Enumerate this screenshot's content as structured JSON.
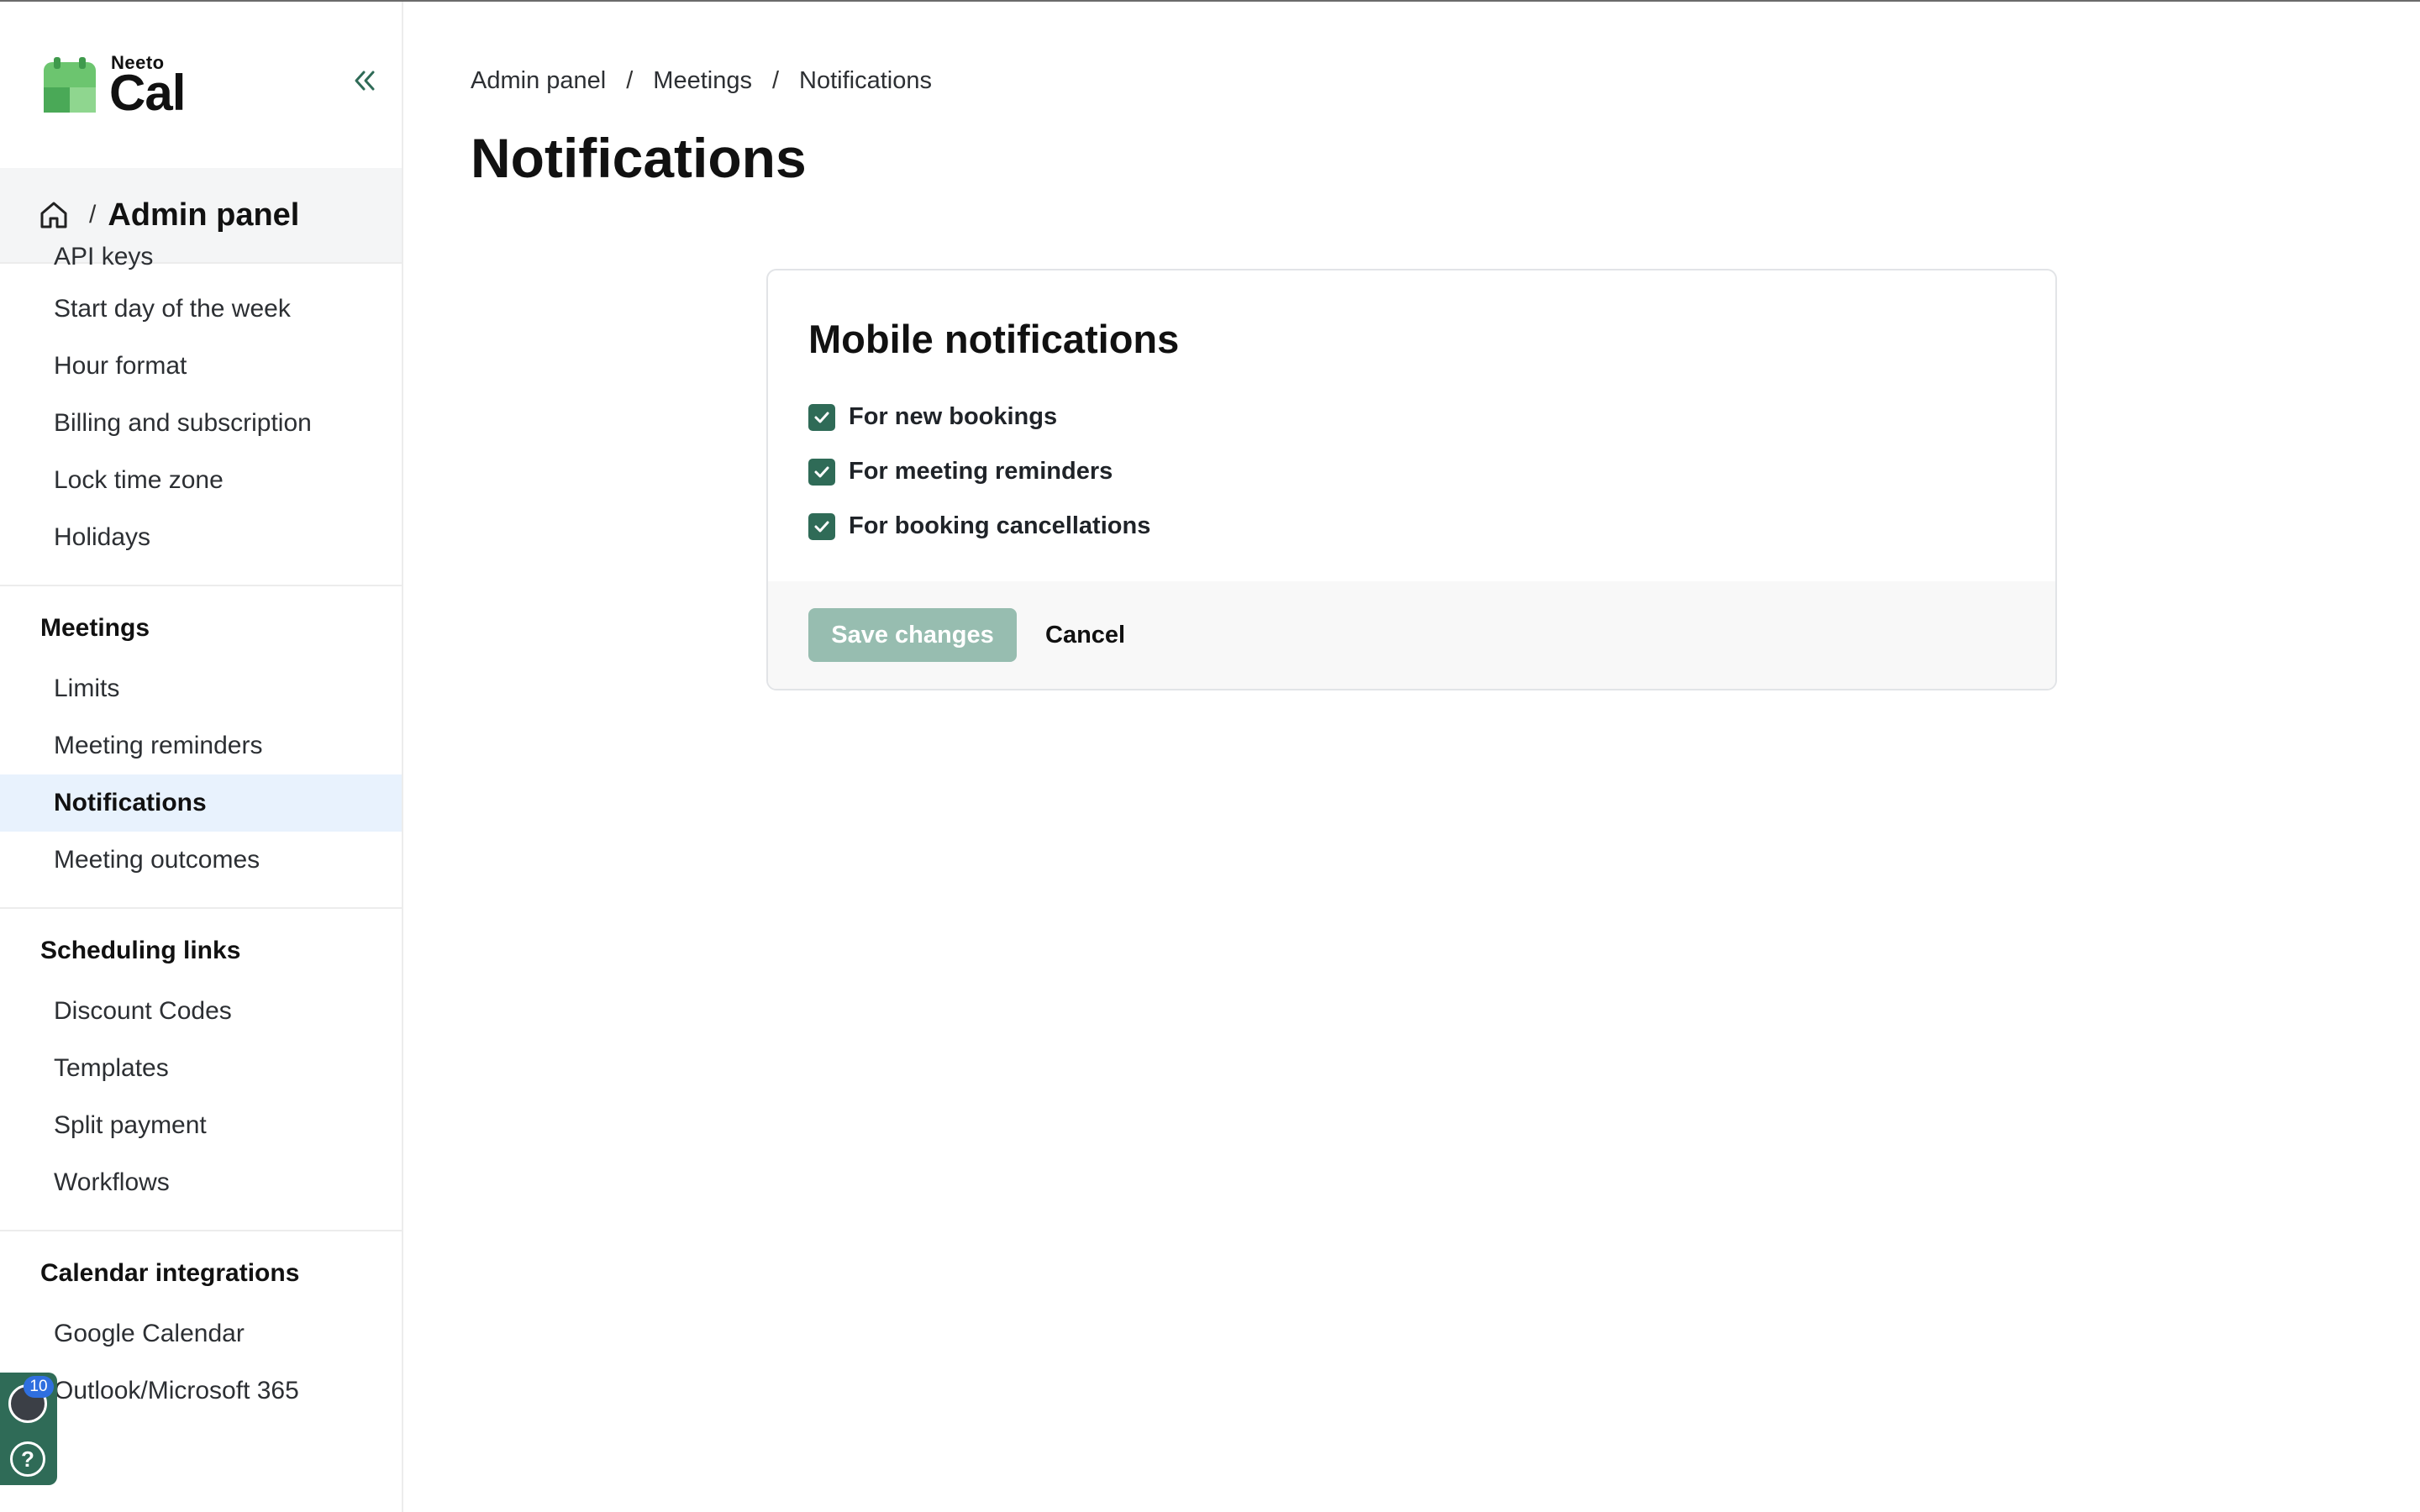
{
  "app": {
    "brand_small": "Neeto",
    "brand_big": "Cal"
  },
  "sidebar": {
    "crumb_separator": "/",
    "crumb_title": "Admin panel",
    "general_items": [
      {
        "label": "API keys"
      },
      {
        "label": "Start day of the week"
      },
      {
        "label": "Hour format"
      },
      {
        "label": "Billing and subscription"
      },
      {
        "label": "Lock time zone"
      },
      {
        "label": "Holidays"
      }
    ],
    "sections": [
      {
        "heading": "Meetings",
        "items": [
          "Limits",
          "Meeting reminders",
          "Notifications",
          "Meeting outcomes"
        ],
        "active": "Notifications"
      },
      {
        "heading": "Scheduling links",
        "items": [
          "Discount Codes",
          "Templates",
          "Split payment",
          "Workflows"
        ]
      },
      {
        "heading": "Calendar integrations",
        "items": [
          "Google Calendar",
          "Outlook/Microsoft 365"
        ]
      }
    ]
  },
  "breadcrumb": {
    "items": [
      "Admin panel",
      "Meetings",
      "Notifications"
    ],
    "separator": "/"
  },
  "page": {
    "title": "Notifications"
  },
  "card": {
    "title": "Mobile notifications",
    "options": [
      {
        "label": "For new bookings",
        "checked": true
      },
      {
        "label": "For meeting reminders",
        "checked": true
      },
      {
        "label": "For booking cancellations",
        "checked": true
      }
    ],
    "save_label": "Save changes",
    "cancel_label": "Cancel"
  },
  "widget": {
    "badge_count": "10",
    "help_glyph": "?"
  },
  "colors": {
    "brand_green": "#2f6b57",
    "active_bg": "#e8f2fd",
    "save_disabled": "#97bdb0",
    "logo_green": "#5bbf6b"
  }
}
